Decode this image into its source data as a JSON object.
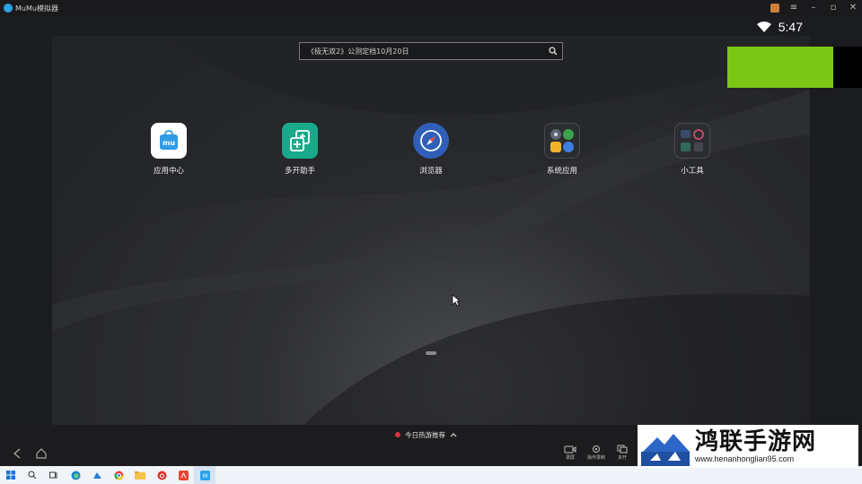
{
  "window": {
    "title": "MuMu模拟器"
  },
  "status": {
    "time": "5:47"
  },
  "search": {
    "placeholder": "《极无双2》公测定档10月20日"
  },
  "apps": [
    {
      "label": "应用中心",
      "icon": "mumu-app-center-icon",
      "color": "#ffffff"
    },
    {
      "label": "多开助手",
      "icon": "multi-open-icon",
      "color": "#1aa98a"
    },
    {
      "label": "浏览器",
      "icon": "compass-browser-icon",
      "color": "#2f5fb8"
    },
    {
      "label": "系统应用",
      "icon": "system-apps-folder-icon",
      "color": "#2c2d31"
    },
    {
      "label": "小工具",
      "icon": "tools-folder-icon",
      "color": "#2c2d31"
    }
  ],
  "bottom": {
    "recommend": "今日热游推荐",
    "tools": [
      {
        "label": "录屏",
        "icon": "record-icon"
      },
      {
        "label": "操作录制",
        "icon": "macro-record-icon"
      },
      {
        "label": "多开",
        "icon": "multi-window-icon"
      }
    ]
  },
  "watermark": {
    "title": "鸿联手游网",
    "url": "www.henanhonglian95.com"
  },
  "colors": {
    "accent_green": "#7bc617",
    "record_red": "#e0303a"
  }
}
